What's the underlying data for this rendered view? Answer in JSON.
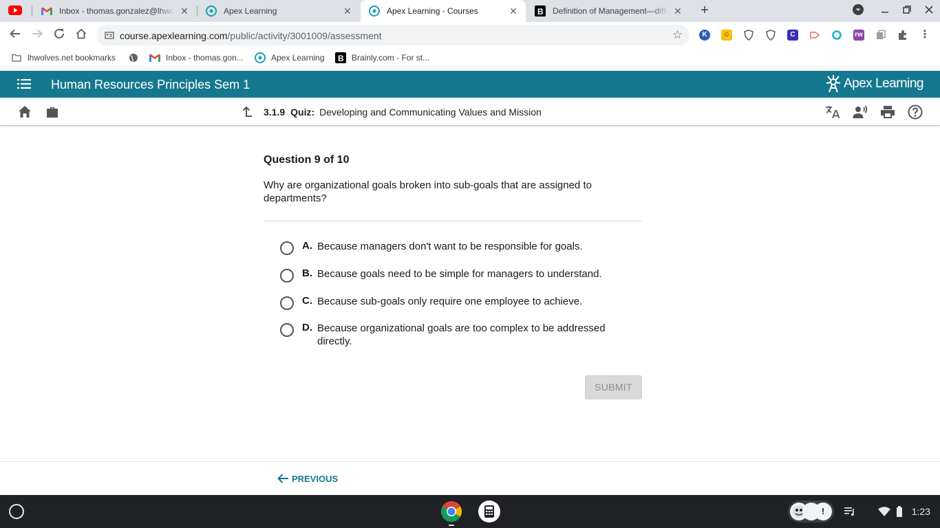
{
  "browser": {
    "tabs": [
      {
        "title": "Inbox - thomas.gonzalez@lhwolves.net",
        "active": false
      },
      {
        "title": "Apex Learning",
        "active": false
      },
      {
        "title": "Apex Learning - Courses",
        "active": true
      },
      {
        "title": "Definition of Management—different definitions",
        "active": false
      }
    ],
    "url_host": "course.apexlearning.com",
    "url_path": "/public/activity/3001009/assessment",
    "bookmarks": [
      {
        "label": "lhwolves.net bookmarks"
      },
      {
        "label": ""
      },
      {
        "label": "Inbox - thomas.gon..."
      },
      {
        "label": "Apex Learning"
      },
      {
        "label": "Brainly.com - For st..."
      }
    ],
    "extensions": [
      {
        "text": "K",
        "color": "#2b5db5"
      },
      {
        "text": "☺",
        "color": "#f4c20d"
      },
      {
        "text": "",
        "color": "#5f6368"
      },
      {
        "text": "",
        "color": "#5f6368"
      },
      {
        "text": "C",
        "color": "#3b2db8"
      },
      {
        "text": "",
        "color": "#f28b82"
      },
      {
        "text": "",
        "color": "#12b5cb"
      },
      {
        "text": "rw",
        "color": "#8e44ad"
      },
      {
        "text": "",
        "color": "#9aa0a6"
      }
    ]
  },
  "course": {
    "title": "Human Resources Principles Sem 1",
    "logo_text": "Apex Learning"
  },
  "activity": {
    "number": "3.1.9",
    "kind": "Quiz:",
    "title": "Developing and Communicating Values and Mission"
  },
  "question": {
    "heading": "Question 9 of 10",
    "text": "Why are organizational goals broken into sub-goals that are assigned to departments?",
    "choices": [
      {
        "letter": "A.",
        "text": "Because managers don't want to be responsible for goals."
      },
      {
        "letter": "B.",
        "text": "Because goals need to be simple for managers to understand."
      },
      {
        "letter": "C.",
        "text": "Because sub-goals only require one employee to achieve."
      },
      {
        "letter": "D.",
        "text": "Because organizational goals are too complex to be addressed directly."
      }
    ],
    "submit_label": "SUBMIT"
  },
  "footer": {
    "previous_label": "PREVIOUS"
  },
  "shelf": {
    "clock": "1:23"
  },
  "colors": {
    "apex_teal": "#15788f",
    "shelf_bg": "#202124"
  }
}
